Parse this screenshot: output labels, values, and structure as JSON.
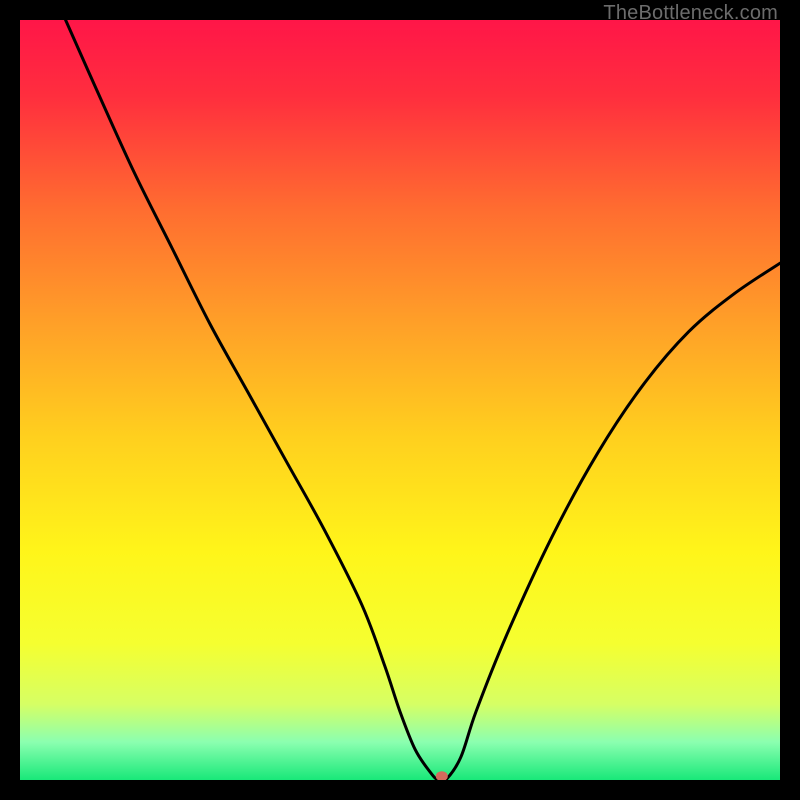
{
  "watermark": "TheBottleneck.com",
  "chart_data": {
    "type": "line",
    "title": "",
    "xlabel": "",
    "ylabel": "",
    "xlim": [
      0,
      100
    ],
    "ylim": [
      0,
      100
    ],
    "background_gradient": {
      "stops": [
        {
          "offset": 0.0,
          "color": "#ff1648"
        },
        {
          "offset": 0.1,
          "color": "#ff2e3e"
        },
        {
          "offset": 0.25,
          "color": "#ff6d30"
        },
        {
          "offset": 0.4,
          "color": "#ffa028"
        },
        {
          "offset": 0.55,
          "color": "#ffd01e"
        },
        {
          "offset": 0.7,
          "color": "#fff51a"
        },
        {
          "offset": 0.82,
          "color": "#f5ff30"
        },
        {
          "offset": 0.9,
          "color": "#d6ff64"
        },
        {
          "offset": 0.95,
          "color": "#8bffb0"
        },
        {
          "offset": 1.0,
          "color": "#18e879"
        }
      ]
    },
    "series": [
      {
        "name": "bottleneck-curve",
        "color": "#000000",
        "x": [
          6,
          10,
          15,
          20,
          25,
          30,
          35,
          40,
          45,
          48,
          50,
          52,
          54,
          55,
          56,
          58,
          60,
          64,
          70,
          76,
          82,
          88,
          94,
          100
        ],
        "values": [
          100,
          91,
          80,
          70,
          60,
          51,
          42,
          33,
          23,
          15,
          9,
          4,
          1,
          0,
          0,
          3,
          9,
          19,
          32,
          43,
          52,
          59,
          64,
          68
        ]
      }
    ],
    "marker": {
      "name": "optimum-point",
      "x": 55.5,
      "y": 0.5,
      "color": "#d36a5c",
      "rx": 6,
      "ry": 5
    }
  }
}
